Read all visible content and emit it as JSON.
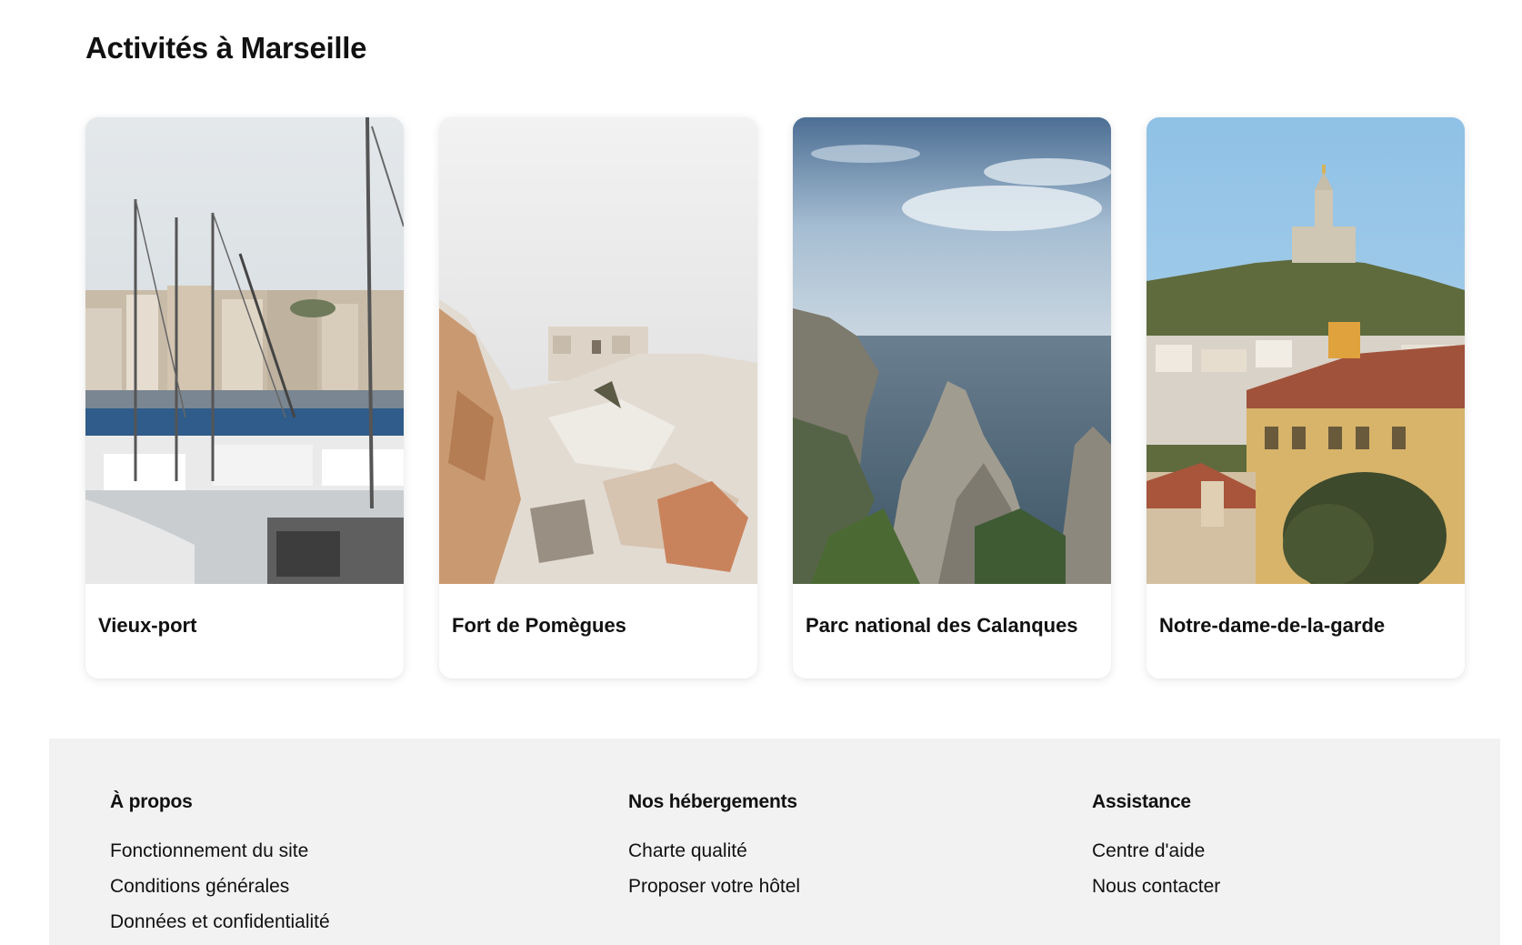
{
  "section": {
    "title": "Activités à Marseille"
  },
  "cards": [
    {
      "label": "Vieux-port",
      "image": "vieux-port-image"
    },
    {
      "label": "Fort de Pomègues",
      "image": "fort-de-pomegues-image"
    },
    {
      "label": "Parc national des Calanques",
      "image": "calanques-image"
    },
    {
      "label": "Notre-dame-de-la-garde",
      "image": "notre-dame-image"
    }
  ],
  "footer": {
    "columns": [
      {
        "title": "À propos",
        "links": [
          "Fonctionnement du site",
          "Conditions générales",
          "Données et confidentialité"
        ]
      },
      {
        "title": "Nos hébergements",
        "links": [
          "Charte qualité",
          "Proposer votre hôtel"
        ]
      },
      {
        "title": "Assistance",
        "links": [
          "Centre d'aide",
          "Nous contacter"
        ]
      }
    ]
  },
  "colors": {
    "footer_bg": "#f2f2f2",
    "text": "#111111"
  }
}
